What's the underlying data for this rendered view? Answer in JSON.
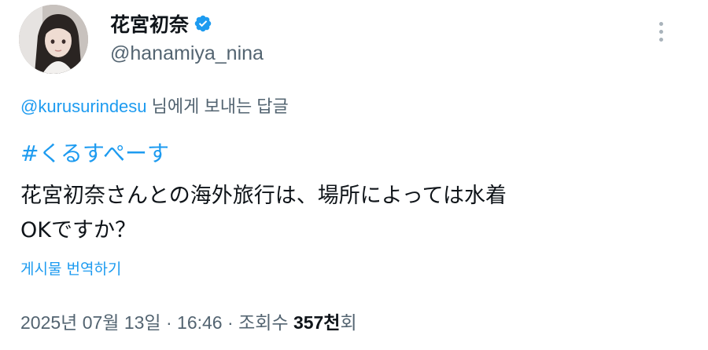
{
  "author": {
    "display_name": "花宮初奈",
    "handle": "@hanamiya_nina",
    "verified": true,
    "avatar_icon": "avatar-photo",
    "verified_icon": "verified-badge-icon",
    "verified_color": "#1d9bf0"
  },
  "more_menu": {
    "icon": "more-vertical-icon"
  },
  "reply_context": {
    "mention": "@kurusurindesu",
    "suffix": " 님에게 보내는 답글"
  },
  "tweet": {
    "hashtag": "#くるすぺーす",
    "text_lines": [
      "花宮初奈さんとの海外旅行は、場所によっては水着",
      "OKですか？"
    ],
    "translate_label": "게시물 번역하기"
  },
  "meta": {
    "date": "2025년 07월 13일",
    "separator": " · ",
    "time": "16:46",
    "views_label": "조회수 ",
    "views_count": "357천",
    "views_suffix": "회"
  },
  "colors": {
    "accent": "#1d9bf0",
    "secondary_text": "#536471",
    "primary_text": "#0f1419"
  }
}
